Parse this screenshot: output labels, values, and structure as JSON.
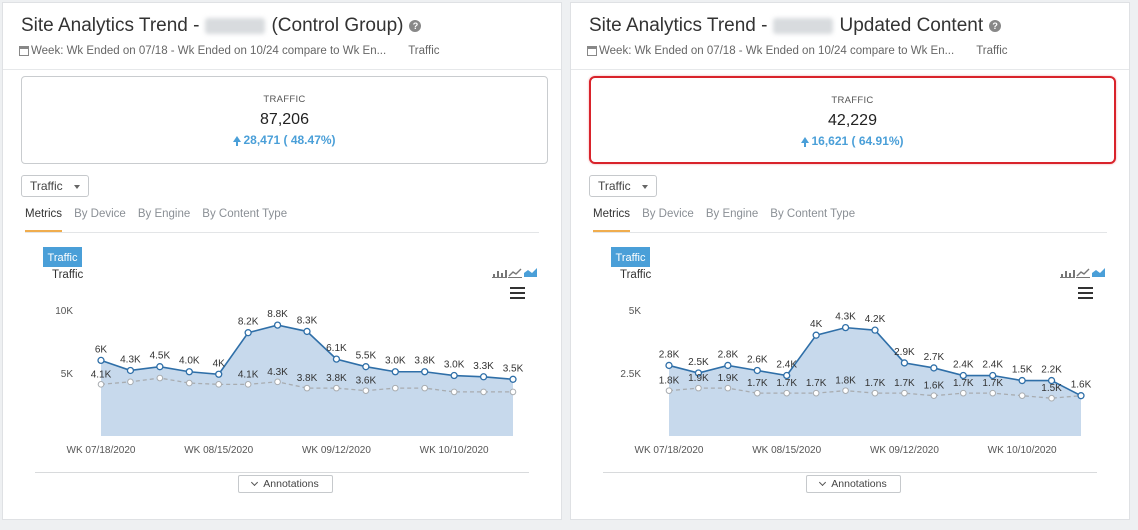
{
  "panels": [
    {
      "title_prefix": "Site Analytics Trend -",
      "title_suffix": "(Control Group)",
      "date_range": "Week: Wk Ended on 07/18 - Wk Ended on 10/24 compare to Wk En...",
      "metric_tag": "Traffic",
      "kpi": {
        "label": "TRAFFIC",
        "value": "87,206",
        "change": "28,471 ( 48.47%)"
      },
      "select_value": "Traffic",
      "tabs": [
        "Metrics",
        "By Device",
        "By Engine",
        "By Content Type"
      ],
      "chart_legend": "Traffic",
      "chart_label": "Traffic",
      "annotations_label": "Annotations",
      "highlighted": false
    },
    {
      "title_prefix": "Site Analytics Trend -",
      "title_suffix": "Updated Content",
      "date_range": "Week: Wk Ended on 07/18 - Wk Ended on 10/24 compare to Wk En...",
      "metric_tag": "Traffic",
      "kpi": {
        "label": "TRAFFIC",
        "value": "42,229",
        "change": "16,621 ( 64.91%)"
      },
      "select_value": "Traffic",
      "tabs": [
        "Metrics",
        "By Device",
        "By Engine",
        "By Content Type"
      ],
      "chart_legend": "Traffic",
      "chart_label": "Traffic",
      "annotations_label": "Annotations",
      "highlighted": true
    }
  ],
  "colors": {
    "accent": "#4a9fd8",
    "highlight": "#d9232b",
    "series_current": "#2f6fa8",
    "series_prior": "#a8acb0",
    "area_fill": "#c7d9ec"
  },
  "chart_data": [
    {
      "type": "area",
      "title": "Traffic",
      "x_ticks": [
        "WK 07/18/2020",
        "WK 08/15/2020",
        "WK 09/12/2020",
        "WK 10/10/2020"
      ],
      "y_ticks": [
        "10K",
        "5K"
      ],
      "ylim": [
        0,
        10000
      ],
      "series": [
        {
          "name": "Traffic",
          "values": [
            6000,
            5200,
            5500,
            5100,
            4900,
            8200,
            8800,
            8300,
            6100,
            5500,
            5100,
            5100,
            4800,
            4700,
            4500
          ],
          "labels": [
            "6K",
            "4.3K",
            "4.5K",
            "4.0K",
            "4K",
            "8.2K",
            "8.8K",
            "8.3K",
            "6.1K",
            "5.5K",
            "3.0K",
            "3.8K",
            "3.0K",
            "3.3K",
            "3.5K"
          ]
        },
        {
          "values": [
            4100,
            4300,
            4600,
            4200,
            4100,
            4100,
            4300,
            3800,
            3800,
            3600,
            3800,
            3800,
            3500,
            3500,
            3500
          ],
          "labels": [
            "4.1K",
            "",
            "",
            "",
            "",
            "4.1K",
            "4.3K",
            "3.8K",
            "3.8K",
            "3.6K",
            "",
            "",
            "",
            "",
            ""
          ]
        }
      ]
    },
    {
      "type": "area",
      "title": "Traffic",
      "x_ticks": [
        "WK 07/18/2020",
        "WK 08/15/2020",
        "WK 09/12/2020",
        "WK 10/10/2020"
      ],
      "y_ticks": [
        "5K",
        "2.5K"
      ],
      "ylim": [
        0,
        5000
      ],
      "series": [
        {
          "name": "Traffic",
          "values": [
            2800,
            2500,
            2800,
            2600,
            2400,
            4000,
            4300,
            4200,
            2900,
            2700,
            2400,
            2400,
            2200,
            2200,
            1600
          ],
          "labels": [
            "2.8K",
            "2.5K",
            "2.8K",
            "2.6K",
            "2.4K",
            "4K",
            "4.3K",
            "4.2K",
            "2.9K",
            "2.7K",
            "2.4K",
            "2.4K",
            "1.5K",
            "2.2K",
            "1.6K"
          ]
        },
        {
          "values": [
            1800,
            1900,
            1900,
            1700,
            1700,
            1700,
            1800,
            1700,
            1700,
            1600,
            1700,
            1700,
            1600,
            1500,
            1600
          ],
          "labels": [
            "1.8K",
            "1.9K",
            "1.9K",
            "1.7K",
            "1.7K",
            "1.7K",
            "1.8K",
            "1.7K",
            "1.7K",
            "1.6K",
            "1.7K",
            "1.7K",
            "",
            "1.5K",
            ""
          ]
        }
      ]
    }
  ]
}
